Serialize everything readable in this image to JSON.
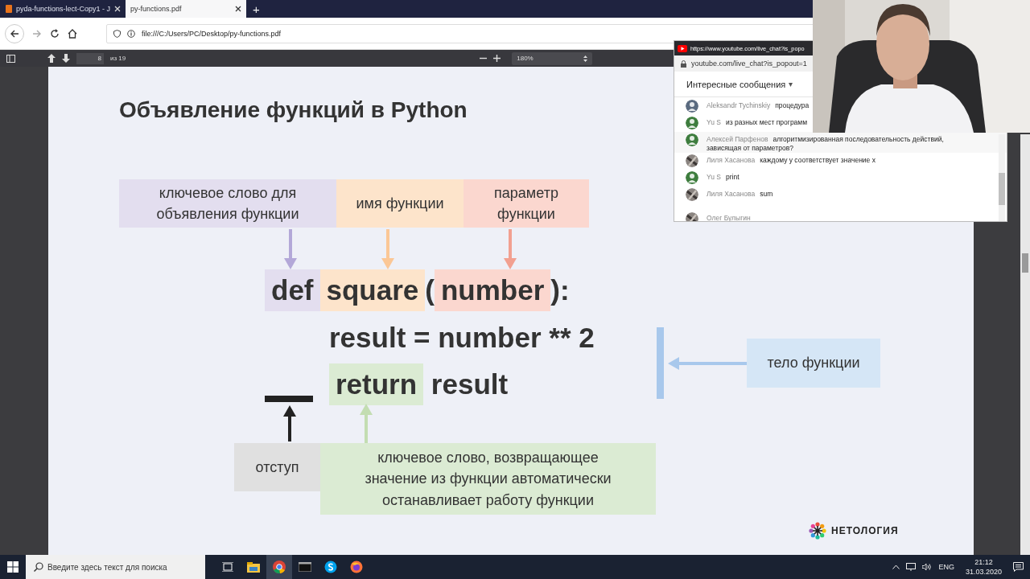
{
  "browser": {
    "tabs": [
      {
        "title": "pyda-functions-lect-Copy1 - J",
        "selected": false
      },
      {
        "title": "py-functions.pdf",
        "selected": true
      }
    ],
    "new_tab": "+",
    "address": "file:///C:/Users/PC/Desktop/py-functions.pdf"
  },
  "pdf_toolbar": {
    "page": "8",
    "page_count": "из 19",
    "zoom": "180%"
  },
  "slide": {
    "title": "Объявление функций в Python",
    "labels": [
      {
        "text": "ключевое слово для\nобъявления функции",
        "color": "#e3deef"
      },
      {
        "text": "имя функции",
        "color": "#fde4cb"
      },
      {
        "text": "параметр\nфункции",
        "color": "#fbd7cf"
      },
      {
        "text": "тело функции",
        "color": "#d5e6f6"
      },
      {
        "text": "отступ",
        "color": "#e0e0e0"
      },
      {
        "text": "ключевое слово, возвращающее\nзначение из функции автоматически\nостанавливает работу функции",
        "color": "#dbebd3"
      }
    ],
    "code": [
      {
        "tokens": [
          {
            "text": "def",
            "color": "#e3deef"
          },
          {
            "text": "square",
            "color": "#fde4cb"
          },
          {
            "text": "("
          },
          {
            "text": "number",
            "color": "#fbd7cf"
          },
          {
            "text": "):"
          }
        ]
      },
      {
        "tokens": [
          {
            "text": "result = number ** 2"
          }
        ]
      },
      {
        "tokens": [
          {
            "text": "return",
            "color": "#dbebd3"
          },
          {
            "text": " result"
          }
        ]
      }
    ],
    "logo": "НЕТОЛОГИЯ"
  },
  "chat": {
    "window_url": "https://www.youtube.com/live_chat?is_popo",
    "address": "youtube.com/live_chat?is_popout=1",
    "header": "Интересные сообщения",
    "header_caret": "▾",
    "messages": [
      {
        "author": "Aleksandr Tychinskiy",
        "text": "процедура",
        "color": "#5b6b80",
        "hovered": false
      },
      {
        "author": "Yu S",
        "text": "из разных мест программ",
        "color": "#3e7d3e",
        "hovered": false
      },
      {
        "author": "Алексей Парфенов",
        "text": "алгоритмизированная последовательность действий, зависящая от параметров?",
        "color": "#3e7d3e",
        "hovered": true
      },
      {
        "author": "Лиля Хасанова",
        "text": "каждому у соответствует значение х",
        "hovered": false
      },
      {
        "author": "Yu S",
        "text": "print",
        "color": "#3e7d3e",
        "hovered": false
      },
      {
        "author": "Лиля Хасанова",
        "text": "sum",
        "hovered": false
      },
      {
        "author": "Олег Булыгин",
        "hovered": false
      }
    ]
  },
  "taskbar": {
    "search_placeholder": "Введите здесь текст для поиска",
    "language": "ENG",
    "time": "21:12",
    "date": "31.03.2020"
  }
}
